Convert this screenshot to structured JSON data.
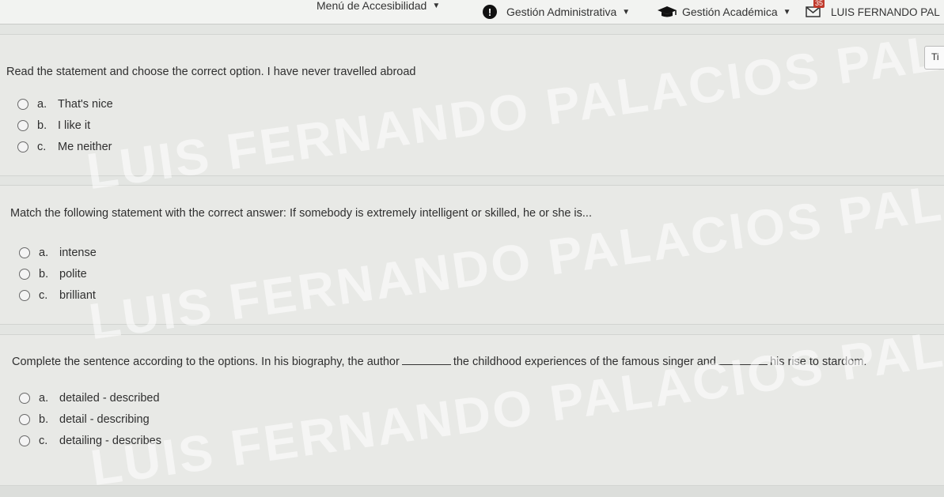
{
  "navbar": {
    "accessibility_menu": "Menú de Accesibilidad",
    "gestion_administrativa": "Gestión Administrativa",
    "gestion_academica": "Gestión Académica",
    "mail_badge": "35",
    "user_name": "LUIS FERNANDO PAL"
  },
  "side_tab": "Ti",
  "questions": [
    {
      "text": "Read the statement and choose the correct option. I have never travelled abroad",
      "options": [
        {
          "letter": "a.",
          "label": "That's nice"
        },
        {
          "letter": "b.",
          "label": "I like it"
        },
        {
          "letter": "c.",
          "label": "Me neither"
        }
      ]
    },
    {
      "text": "Match the following statement with the correct answer: If somebody is extremely intelligent or skilled, he or she is...",
      "options": [
        {
          "letter": "a.",
          "label": "intense"
        },
        {
          "letter": "b.",
          "label": "polite"
        },
        {
          "letter": "c.",
          "label": "brilliant"
        }
      ]
    },
    {
      "text_parts": [
        "Complete the sentence according to the options. In his biography, the author",
        "the childhood experiences of the famous singer and",
        "his rise to stardom."
      ],
      "options": [
        {
          "letter": "a.",
          "label": "detailed - described"
        },
        {
          "letter": "b.",
          "label": "detail - describing"
        },
        {
          "letter": "c.",
          "label": "detailing - describes"
        }
      ]
    }
  ],
  "watermark": {
    "line1": "LUIS FERNANDO PALACIOS PALACIOS",
    "line2": "LUIS FERNANDO PALACIOS PALACIOS",
    "line3": "LUIS FERNANDO PALACIOS PALACIOS"
  }
}
